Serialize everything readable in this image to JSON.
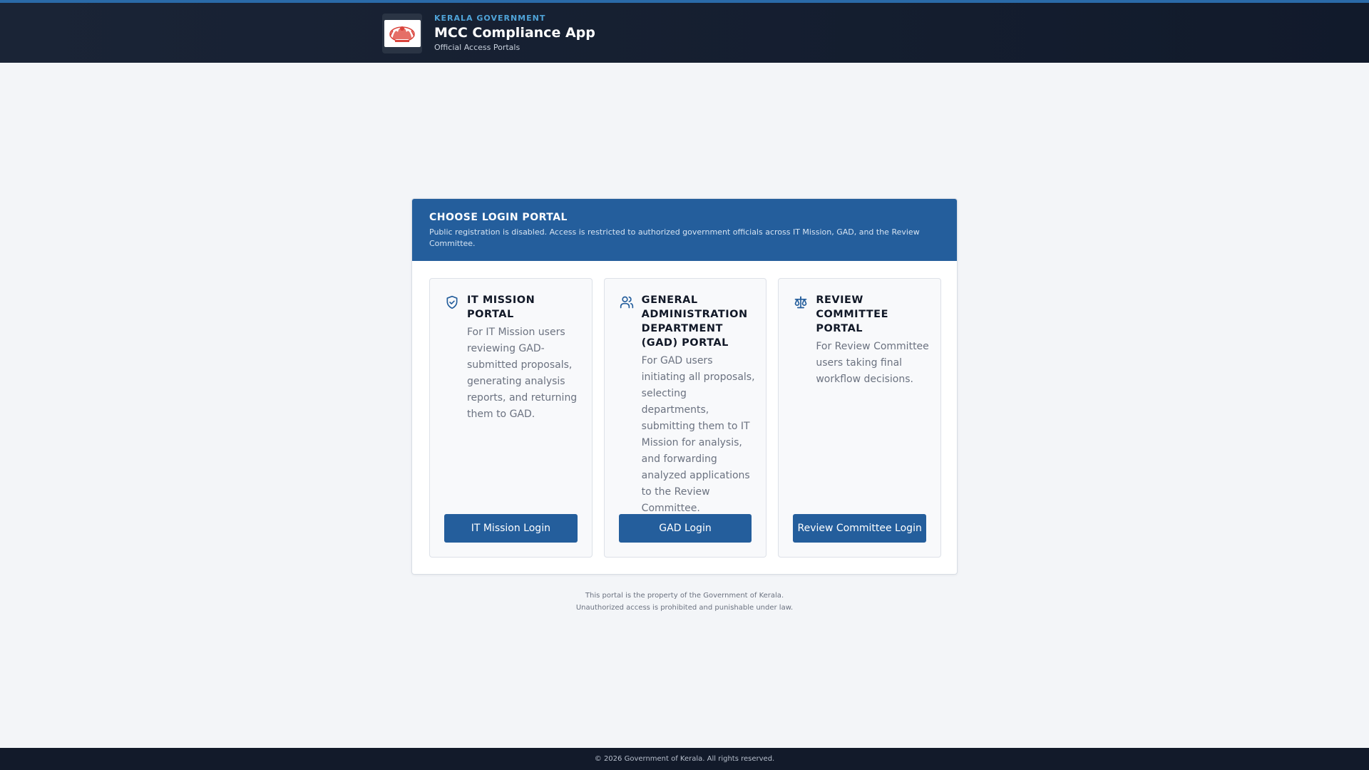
{
  "header": {
    "government": "KERALA GOVERNMENT",
    "title": "MCC Compliance App",
    "subtitle": "Official Access Portals",
    "logo_icon": "kerala-emblem-icon"
  },
  "login_card": {
    "title": "CHOOSE LOGIN PORTAL",
    "description": "Public registration is disabled. Access is restricted to authorized government officials across IT Mission, GAD, and the Review Committee."
  },
  "portals": [
    {
      "icon": "shield-check-icon",
      "title": "IT Mission Portal",
      "description": "For IT Mission users reviewing GAD-submitted proposals, generating analysis reports, and returning them to GAD.",
      "button_label": "IT Mission Login"
    },
    {
      "icon": "users-icon",
      "title": "General Administration Department (GAD) Portal",
      "description": "For GAD users initiating all proposals, selecting departments, submitting them to IT Mission for analysis, and forwarding analyzed applications to the Review Committee.",
      "button_label": "GAD Login"
    },
    {
      "icon": "scale-icon",
      "title": "Review Committee Portal",
      "description": "For Review Committee users taking final workflow decisions.",
      "button_label": "Review Committee Login"
    }
  ],
  "notice": {
    "line1": "This portal is the property of the Government of Kerala.",
    "line2": "Unauthorized access is prohibited and punishable under law."
  },
  "footer": {
    "copyright": "© 2026 Government of Kerala. All rights reserved."
  },
  "colors": {
    "primary": "#245e9c",
    "header_bg": "#161f30",
    "accent": "#4fa3d8",
    "page_bg": "#f3f5f8"
  }
}
